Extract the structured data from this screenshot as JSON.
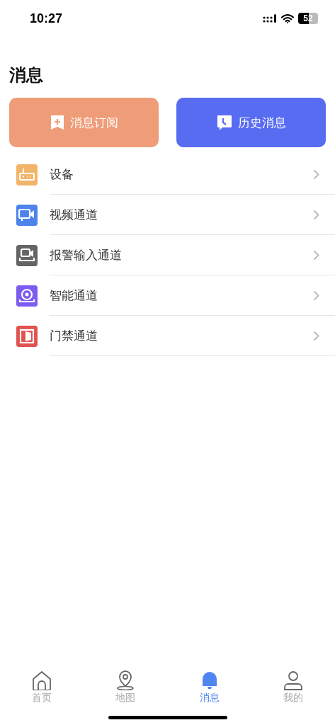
{
  "status_bar": {
    "time": "10:27",
    "battery": "52"
  },
  "title": "消息",
  "actions": [
    {
      "label": "消息订阅",
      "kind": "subscribe",
      "color": "#ef9c78"
    },
    {
      "label": "历史消息",
      "kind": "history",
      "color": "#586cf2"
    }
  ],
  "items": [
    {
      "label": "设备",
      "kind": "device",
      "color": "#f2b46a"
    },
    {
      "label": "视频通道",
      "kind": "video",
      "color": "#4d84ec"
    },
    {
      "label": "报警输入通道",
      "kind": "alarm",
      "color": "#646464"
    },
    {
      "label": "智能通道",
      "kind": "smart",
      "color": "#7b5cf0"
    },
    {
      "label": "门禁通道",
      "kind": "door",
      "color": "#e0534f"
    }
  ],
  "tab_bar": [
    {
      "label": "首页",
      "kind": "home",
      "selected": false
    },
    {
      "label": "地图",
      "kind": "map",
      "selected": false
    },
    {
      "label": "消息",
      "kind": "bell",
      "selected": true
    },
    {
      "label": "我的",
      "kind": "person",
      "selected": false
    }
  ]
}
